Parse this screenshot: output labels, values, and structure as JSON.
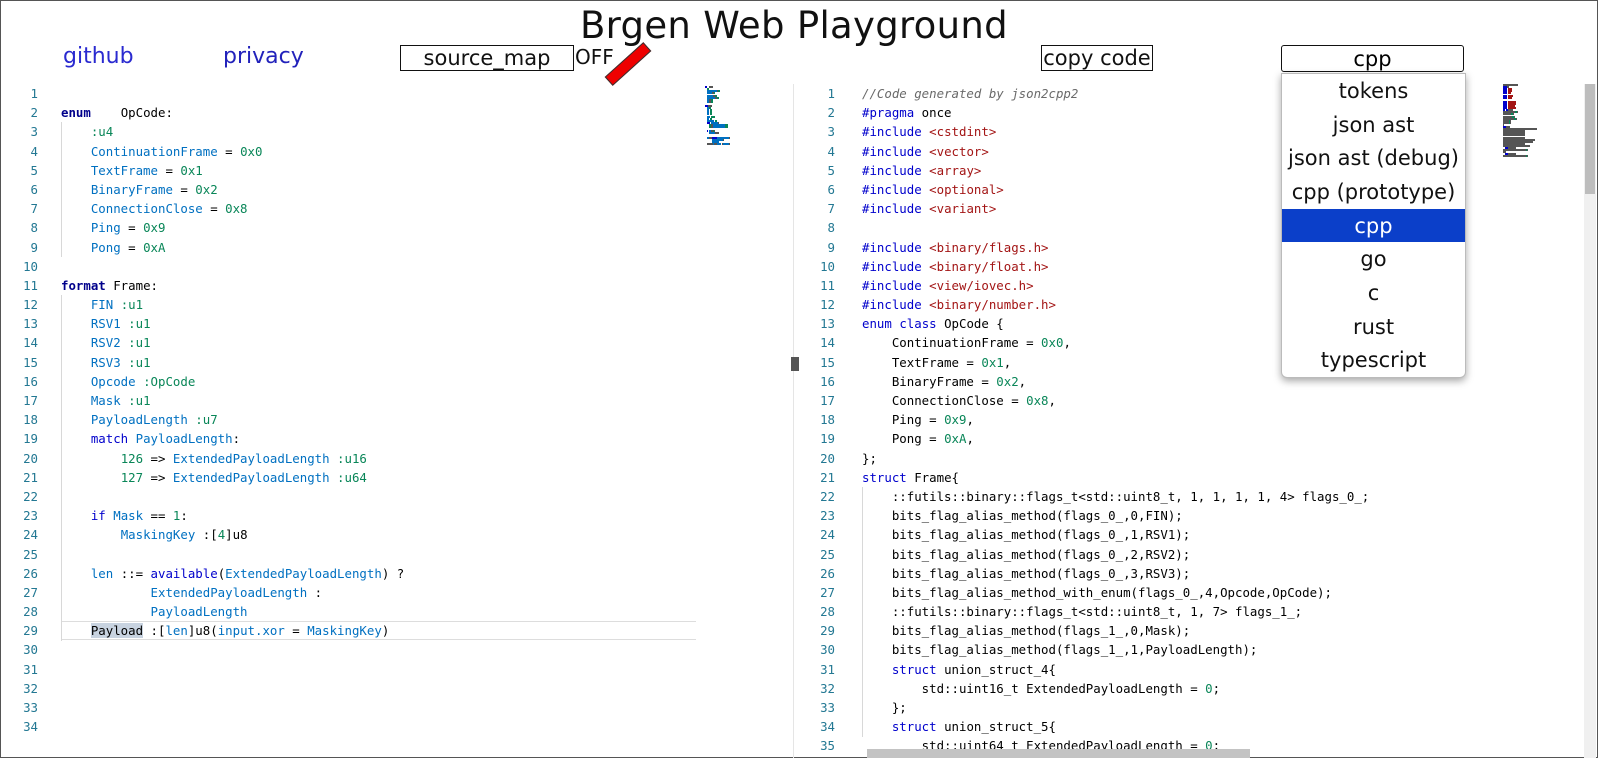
{
  "app": {
    "title": "Brgen Web Playground",
    "links": {
      "github": "github",
      "privacy": "privacy"
    },
    "source_map_label": "source_map",
    "source_map_state": "OFF",
    "copy_label": "copy code",
    "language": {
      "selected": "cpp",
      "options": [
        "tokens",
        "json ast",
        "json ast (debug)",
        "cpp (prototype)",
        "cpp",
        "go",
        "c",
        "rust",
        "typescript"
      ],
      "selected_index": 4
    }
  },
  "colors": {
    "link": "#2a2ad0",
    "selected": "#0b3fc9",
    "line_number": "#237893",
    "keyword": "#0000cc",
    "identifier": "#0070c1",
    "number": "#098658",
    "string": "#a31515"
  },
  "left_editor": {
    "lines": [
      [],
      [
        [
          "kwb",
          "enum"
        ],
        [
          "",
          "    "
        ],
        [
          "",
          "OpCode:"
        ]
      ],
      [
        [
          "",
          "    "
        ],
        [
          "num",
          ":u4"
        ]
      ],
      [
        [
          "",
          "    "
        ],
        [
          "id",
          "ContinuationFrame"
        ],
        [
          "",
          " = "
        ],
        [
          "num",
          "0x0"
        ]
      ],
      [
        [
          "",
          "    "
        ],
        [
          "id",
          "TextFrame"
        ],
        [
          "",
          " = "
        ],
        [
          "num",
          "0x1"
        ]
      ],
      [
        [
          "",
          "    "
        ],
        [
          "id",
          "BinaryFrame"
        ],
        [
          "",
          " = "
        ],
        [
          "num",
          "0x2"
        ]
      ],
      [
        [
          "",
          "    "
        ],
        [
          "id",
          "ConnectionClose"
        ],
        [
          "",
          " = "
        ],
        [
          "num",
          "0x8"
        ]
      ],
      [
        [
          "",
          "    "
        ],
        [
          "id",
          "Ping"
        ],
        [
          "",
          " = "
        ],
        [
          "num",
          "0x9"
        ]
      ],
      [
        [
          "",
          "    "
        ],
        [
          "id",
          "Pong"
        ],
        [
          "",
          " = "
        ],
        [
          "num",
          "0xA"
        ]
      ],
      [],
      [
        [
          "kwb",
          "format"
        ],
        [
          "",
          " Frame:"
        ]
      ],
      [
        [
          "",
          "    "
        ],
        [
          "id",
          "FIN"
        ],
        [
          "",
          " "
        ],
        [
          "num",
          ":u1"
        ]
      ],
      [
        [
          "",
          "    "
        ],
        [
          "id",
          "RSV1"
        ],
        [
          "",
          " "
        ],
        [
          "num",
          ":u1"
        ]
      ],
      [
        [
          "",
          "    "
        ],
        [
          "id",
          "RSV2"
        ],
        [
          "",
          " "
        ],
        [
          "num",
          ":u1"
        ]
      ],
      [
        [
          "",
          "    "
        ],
        [
          "id",
          "RSV3"
        ],
        [
          "",
          " "
        ],
        [
          "num",
          ":u1"
        ]
      ],
      [
        [
          "",
          "    "
        ],
        [
          "id",
          "Opcode"
        ],
        [
          "",
          " "
        ],
        [
          "num",
          ":OpCode"
        ]
      ],
      [
        [
          "",
          "    "
        ],
        [
          "id",
          "Mask"
        ],
        [
          "",
          " "
        ],
        [
          "num",
          ":u1"
        ]
      ],
      [
        [
          "",
          "    "
        ],
        [
          "id",
          "PayloadLength"
        ],
        [
          "",
          " "
        ],
        [
          "num",
          ":u7"
        ]
      ],
      [
        [
          "",
          "    "
        ],
        [
          "kw",
          "match"
        ],
        [
          "",
          " "
        ],
        [
          "id",
          "PayloadLength"
        ],
        [
          "",
          ":"
        ]
      ],
      [
        [
          "",
          "        "
        ],
        [
          "num",
          "126"
        ],
        [
          "",
          " => "
        ],
        [
          "id",
          "ExtendedPayloadLength"
        ],
        [
          "",
          " "
        ],
        [
          "num",
          ":u16"
        ]
      ],
      [
        [
          "",
          "        "
        ],
        [
          "num",
          "127"
        ],
        [
          "",
          " => "
        ],
        [
          "id",
          "ExtendedPayloadLength"
        ],
        [
          "",
          " "
        ],
        [
          "num",
          ":u64"
        ]
      ],
      [],
      [
        [
          "",
          "    "
        ],
        [
          "kw",
          "if"
        ],
        [
          "",
          " "
        ],
        [
          "id",
          "Mask"
        ],
        [
          "",
          " == "
        ],
        [
          "num",
          "1"
        ],
        [
          "",
          ":"
        ]
      ],
      [
        [
          "",
          "        "
        ],
        [
          "id",
          "MaskingKey"
        ],
        [
          "",
          " :["
        ],
        [
          "num",
          "4"
        ],
        [
          "",
          "]u8"
        ]
      ],
      [],
      [
        [
          "",
          "    "
        ],
        [
          "id",
          "len"
        ],
        [
          "",
          " ::= "
        ],
        [
          "kw",
          "available"
        ],
        [
          "",
          "("
        ],
        [
          "id",
          "ExtendedPayloadLength"
        ],
        [
          "",
          ") ?"
        ]
      ],
      [
        [
          "",
          "            "
        ],
        [
          "id",
          "ExtendedPayloadLength"
        ],
        [
          "",
          " :"
        ]
      ],
      [
        [
          "",
          "            "
        ],
        [
          "id",
          "PayloadLength"
        ]
      ],
      [
        [
          "",
          "    "
        ],
        [
          "hl",
          "Payload"
        ],
        [
          "",
          " :["
        ],
        [
          "id",
          "len"
        ],
        [
          "",
          "]u8("
        ],
        [
          "id",
          "input.xor"
        ],
        [
          "",
          " = "
        ],
        [
          "id",
          "MaskingKey"
        ],
        [
          "",
          ")"
        ]
      ],
      [],
      [],
      [],
      [],
      []
    ]
  },
  "right_editor": {
    "lines": [
      [
        [
          "cm",
          "//Code generated by json2cpp2"
        ]
      ],
      [
        [
          "pp",
          "#pragma"
        ],
        [
          "",
          " once"
        ]
      ],
      [
        [
          "pp",
          "#include"
        ],
        [
          "",
          " "
        ],
        [
          "str",
          "<cstdint>"
        ]
      ],
      [
        [
          "pp",
          "#include"
        ],
        [
          "",
          " "
        ],
        [
          "str",
          "<vector>"
        ]
      ],
      [
        [
          "pp",
          "#include"
        ],
        [
          "",
          " "
        ],
        [
          "str",
          "<array>"
        ]
      ],
      [
        [
          "pp",
          "#include"
        ],
        [
          "",
          " "
        ],
        [
          "str",
          "<optional>"
        ]
      ],
      [
        [
          "pp",
          "#include"
        ],
        [
          "",
          " "
        ],
        [
          "str",
          "<variant>"
        ]
      ],
      [],
      [
        [
          "pp",
          "#include"
        ],
        [
          "",
          " "
        ],
        [
          "str",
          "<binary/flags.h>"
        ]
      ],
      [
        [
          "pp",
          "#include"
        ],
        [
          "",
          " "
        ],
        [
          "str",
          "<binary/float.h>"
        ]
      ],
      [
        [
          "pp",
          "#include"
        ],
        [
          "",
          " "
        ],
        [
          "str",
          "<view/iovec.h>"
        ]
      ],
      [
        [
          "pp",
          "#include"
        ],
        [
          "",
          " "
        ],
        [
          "str",
          "<binary/number.h>"
        ]
      ],
      [
        [
          "kw",
          "enum"
        ],
        [
          "",
          " "
        ],
        [
          "kw",
          "class"
        ],
        [
          "",
          " OpCode {"
        ]
      ],
      [
        [
          "",
          "    ContinuationFrame = "
        ],
        [
          "num",
          "0x0"
        ],
        [
          "",
          ","
        ]
      ],
      [
        [
          "",
          "    TextFrame = "
        ],
        [
          "num",
          "0x1"
        ],
        [
          "",
          ","
        ]
      ],
      [
        [
          "",
          "    BinaryFrame = "
        ],
        [
          "num",
          "0x2"
        ],
        [
          "",
          ","
        ]
      ],
      [
        [
          "",
          "    ConnectionClose = "
        ],
        [
          "num",
          "0x8"
        ],
        [
          "",
          ","
        ]
      ],
      [
        [
          "",
          "    Ping = "
        ],
        [
          "num",
          "0x9"
        ],
        [
          "",
          ","
        ]
      ],
      [
        [
          "",
          "    Pong = "
        ],
        [
          "num",
          "0xA"
        ],
        [
          "",
          ","
        ]
      ],
      [
        [
          "",
          "};"
        ]
      ],
      [
        [
          "kw",
          "struct"
        ],
        [
          "",
          " Frame{"
        ]
      ],
      [
        [
          "",
          "    ::futils::binary::flags_t<std::uint8_t, 1, 1, 1, 1, 4> flags_0_;"
        ]
      ],
      [
        [
          "",
          "    bits_flag_alias_method(flags_0_,0,FIN);"
        ]
      ],
      [
        [
          "",
          "    bits_flag_alias_method(flags_0_,1,RSV1);"
        ]
      ],
      [
        [
          "",
          "    bits_flag_alias_method(flags_0_,2,RSV2);"
        ]
      ],
      [
        [
          "",
          "    bits_flag_alias_method(flags_0_,3,RSV3);"
        ]
      ],
      [
        [
          "",
          "    bits_flag_alias_method_with_enum(flags_0_,4,Opcode,OpCode);"
        ]
      ],
      [
        [
          "",
          "    ::futils::binary::flags_t<std::uint8_t, 1, 7> flags_1_;"
        ]
      ],
      [
        [
          "",
          "    bits_flag_alias_method(flags_1_,0,Mask);"
        ]
      ],
      [
        [
          "",
          "    bits_flag_alias_method(flags_1_,1,PayloadLength);"
        ]
      ],
      [
        [
          "",
          "    "
        ],
        [
          "kw",
          "struct"
        ],
        [
          "",
          " union_struct_4{"
        ]
      ],
      [
        [
          "",
          "        std::uint16_t ExtendedPayloadLength = "
        ],
        [
          "num",
          "0"
        ],
        [
          "",
          ";"
        ]
      ],
      [
        [
          "",
          "    };"
        ]
      ],
      [
        [
          "",
          "    "
        ],
        [
          "kw",
          "struct"
        ],
        [
          "",
          " union_struct_5{"
        ]
      ],
      [
        [
          "",
          "        std::uint64_t ExtendedPayloadLength = "
        ],
        [
          "num",
          "0"
        ],
        [
          "",
          ";"
        ]
      ]
    ]
  }
}
